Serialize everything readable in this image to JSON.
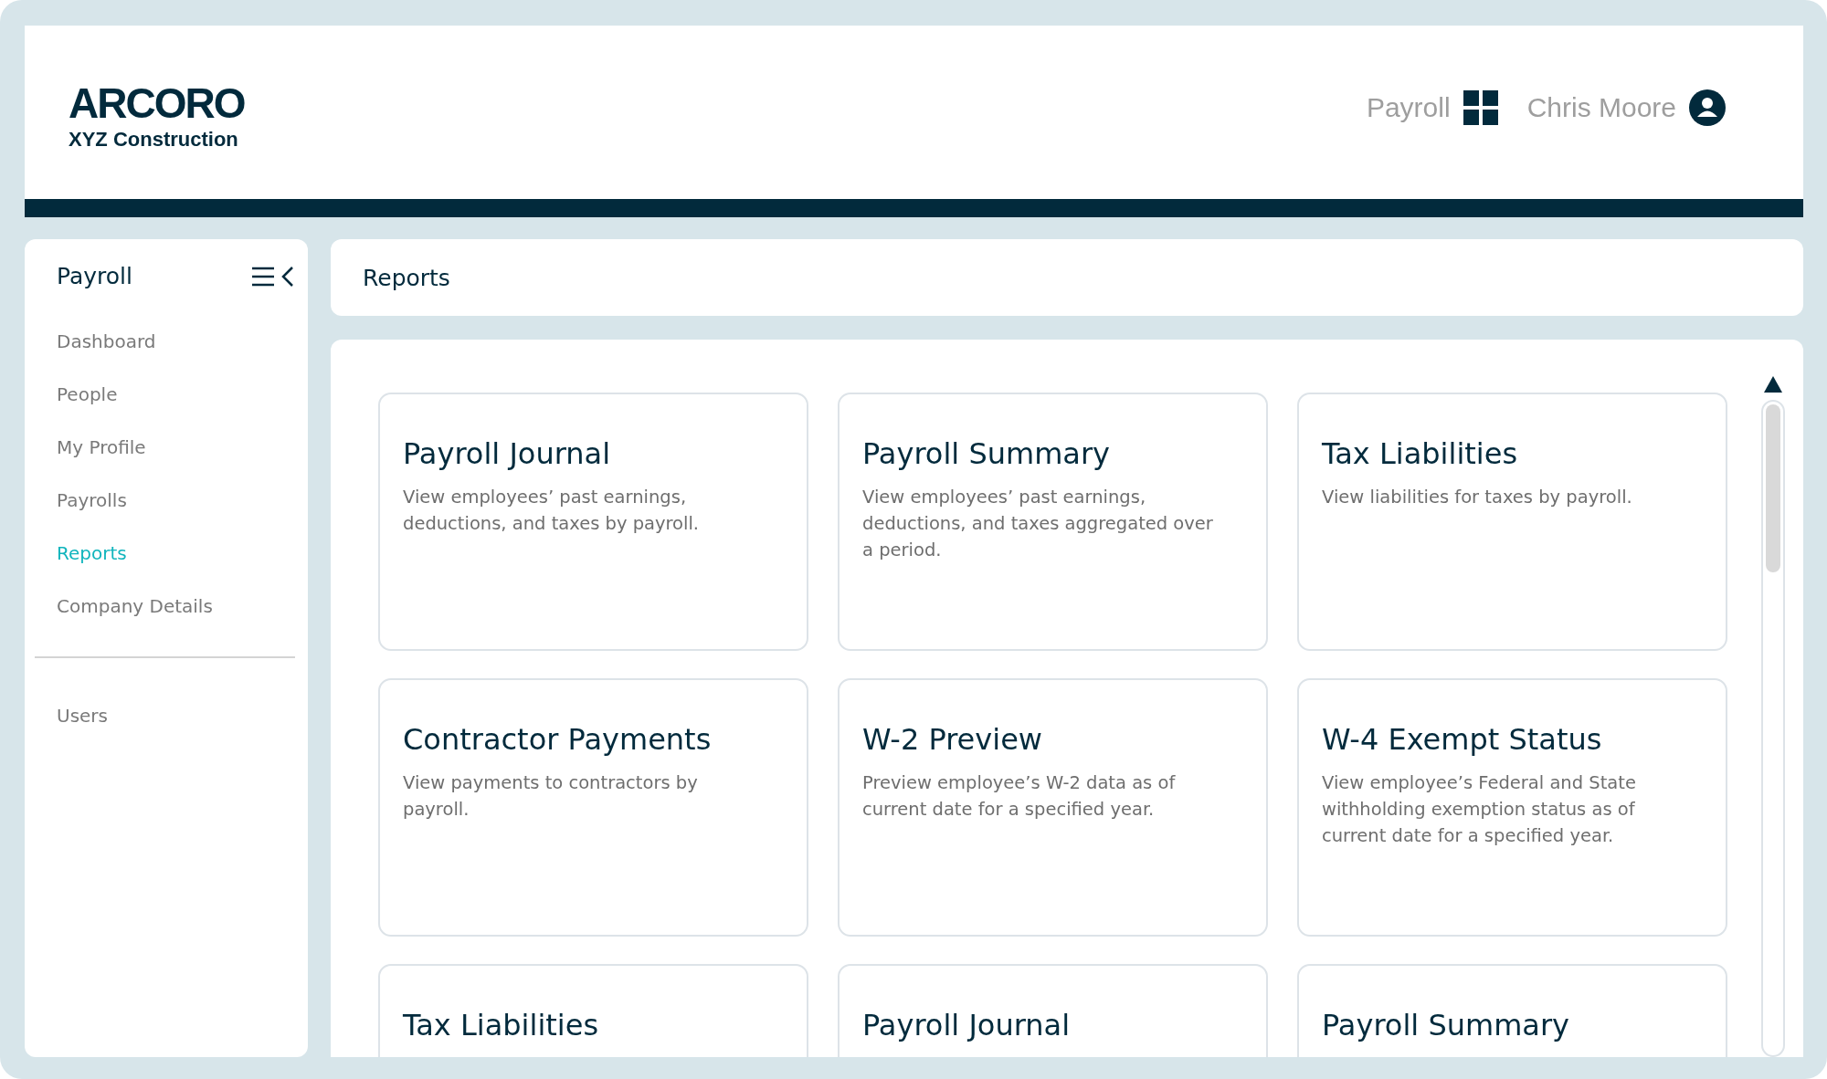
{
  "header": {
    "logo": "ARCORO",
    "company": "XYZ Construction",
    "app_name": "Payroll",
    "user_name": "Chris Moore"
  },
  "sidebar": {
    "title": "Payroll",
    "items": [
      {
        "label": "Dashboard",
        "selected": false
      },
      {
        "label": "People",
        "selected": false
      },
      {
        "label": "My Profile",
        "selected": false
      },
      {
        "label": "Payrolls",
        "selected": false
      },
      {
        "label": "Reports",
        "selected": true
      },
      {
        "label": "Company Details",
        "selected": false
      }
    ],
    "secondary_items": [
      {
        "label": "Users",
        "selected": false
      }
    ]
  },
  "page_title": "Reports",
  "reports": [
    {
      "title": "Payroll Journal",
      "description": "View employees’ past earnings, deductions, and taxes by payroll."
    },
    {
      "title": "Payroll Summary",
      "description": "View employees’ past earnings, deductions, and taxes aggregated over a period."
    },
    {
      "title": "Tax Liabilities",
      "description": "View liabilities for taxes by payroll."
    },
    {
      "title": "Contractor Payments",
      "description": "View payments to contractors by payroll."
    },
    {
      "title": "W-2 Preview",
      "description": "Preview employee’s W-2 data as of current date for a specified year."
    },
    {
      "title": "W-4 Exempt Status",
      "description": "View employee’s Federal and State withholding exemption status as of current date for a specified year."
    },
    {
      "title": "Tax Liabilities"
    },
    {
      "title": "Payroll Journal"
    },
    {
      "title": "Payroll Summary"
    }
  ]
}
